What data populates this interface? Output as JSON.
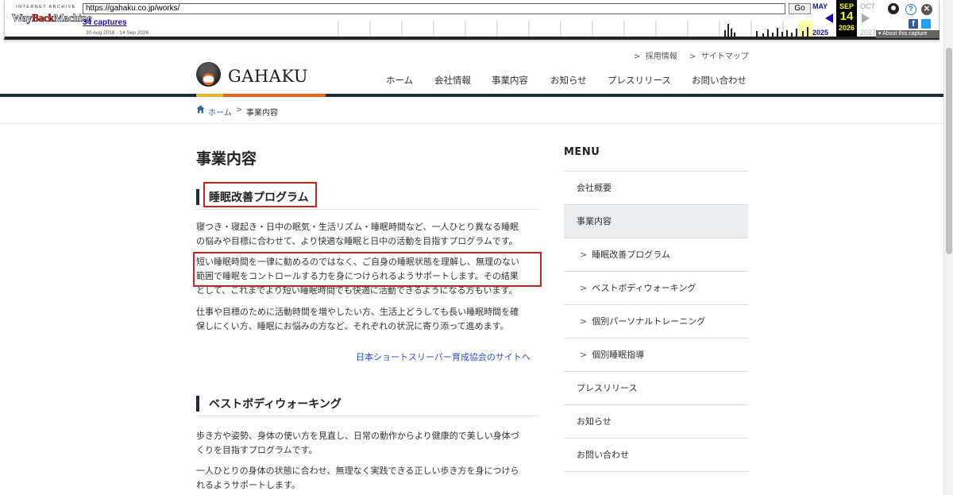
{
  "wayback": {
    "logo_top": "INTERNET ARCHIVE",
    "logo_way": "Way",
    "logo_back": "Back",
    "logo_machine": "Machine",
    "url": "https://gahaku.co.jp/works/",
    "go_label": "Go",
    "captures": "34 captures",
    "date_range": "30 Aug 2018 - 14 Sep 2026",
    "prev_month": "MAY",
    "current_month": "SEP",
    "current_day": "14",
    "next_month": "OCT",
    "prev_year": "2025",
    "current_year": "2026",
    "next_year": "2027",
    "about": "About this capture",
    "help_glyph": "?",
    "close_glyph": "✕",
    "fb_glyph": "f"
  },
  "site": {
    "logo_text": "GAHAKU",
    "utility_links": [
      "採用情報",
      "サイトマップ"
    ],
    "nav": [
      "ホーム",
      "会社情報",
      "事業内容",
      "お知らせ",
      "プレスリリース",
      "お問い合わせ"
    ]
  },
  "breadcrumb": {
    "home": "ホーム",
    "separator": ">",
    "current": "事業内容"
  },
  "main": {
    "page_title": "事業内容",
    "section1": {
      "heading": "睡眠改善プログラム",
      "p1_lines": [
        "寝つき・寝起き・日中の眠気・生活リズム・睡眠時間など、一人ひとり異なる睡眠",
        "の悩みや目標に合わせて、より快適な睡眠と日中の活動を目指すプログラムです。"
      ],
      "p2_lines": [
        "短い睡眠時間を一律に勧めるのではなく、ご自身の睡眠状態を理解し、無理のない",
        "範囲で睡眠をコントロールする力を身につけられるようサポートします。その結果",
        "として、これまでより短い睡眠時間でも快適に活動できるようになる方もいます。"
      ],
      "p3_lines": [
        "仕事や目標のために活動時間を増やしたい方、生活上どうしても長い睡眠時間を確",
        "保しにくい方、睡眠にお悩みの方など、それぞれの状況に寄り添って進めます。"
      ],
      "external_link": "日本ショートスリーパー育成協会のサイトへ"
    },
    "section2": {
      "heading": "ベストボディウォーキング",
      "p1_lines": [
        "歩き方や姿勢、身体の使い方を見直し、日常の動作からより健康的で美しい身体づ",
        "くりを目指すプログラムです。"
      ],
      "p2_lines": [
        "一人ひとりの身体の状態に合わせ、無理なく実践できる正しい歩き方を身につけら",
        "れるようサポートします。"
      ]
    }
  },
  "sidebar": {
    "title": "MENU",
    "chevron": ">",
    "items": [
      {
        "label": "会社概要",
        "sub": false,
        "active": false
      },
      {
        "label": "事業内容",
        "sub": false,
        "active": true
      },
      {
        "label": "睡眠改善プログラム",
        "sub": true,
        "active": false
      },
      {
        "label": "ベストボディウォーキング",
        "sub": true,
        "active": false
      },
      {
        "label": "個別パーソナルトレーニング",
        "sub": true,
        "active": false
      },
      {
        "label": "個別睡眠指導",
        "sub": true,
        "active": false
      },
      {
        "label": "プレスリリース",
        "sub": false,
        "active": false
      },
      {
        "label": "お知らせ",
        "sub": false,
        "active": false
      },
      {
        "label": "お問い合わせ",
        "sub": false,
        "active": false
      }
    ]
  },
  "colors": {
    "accent_navy": "#1c2a3a",
    "accent_orange": "#e9661c",
    "accent_yellow": "#e9b52c",
    "highlight_red": "#d11e1e",
    "link_blue": "#2b4fd1"
  }
}
